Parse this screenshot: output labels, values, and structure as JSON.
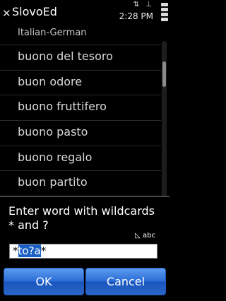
{
  "app": {
    "title": "SlovoEd",
    "clock": "2:28 PM",
    "status_glyphs": "⇅ ⊥"
  },
  "dictionary": {
    "label": "Italian-German"
  },
  "list": {
    "items": [
      "buono del tesoro",
      "buon odore",
      "buono fruttifero",
      "buono pasto",
      "buono regalo",
      "buon partito"
    ],
    "scroll_position": 0.15
  },
  "dialog": {
    "title": "Enter word with wildcards * and ?",
    "input_mode": "abc",
    "input_prefix": "*",
    "input_selected": "to?a",
    "input_suffix": "*",
    "ok_label": "OK",
    "cancel_label": "Cancel"
  },
  "colors": {
    "accent": "#2a6cd6",
    "selection": "#1b60c4"
  }
}
